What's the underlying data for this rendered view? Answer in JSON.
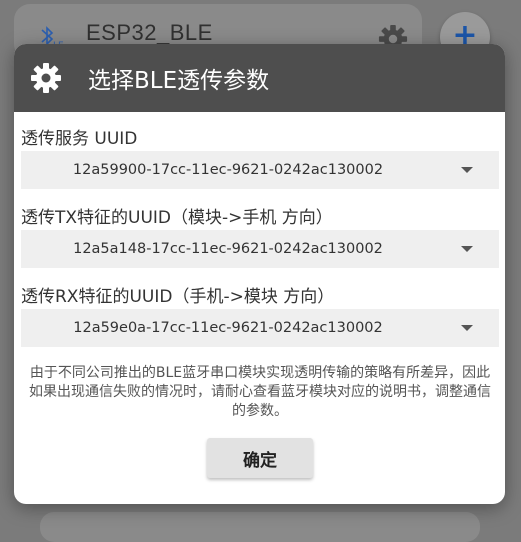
{
  "background": {
    "device_name": "ESP32_BLE",
    "ble_icon": "bluetooth-ble-icon",
    "settings_icon": "gear-icon",
    "add_icon": "plus-icon",
    "add_glyph": "+"
  },
  "dialog": {
    "icon": "gear-icon",
    "title": "选择BLE透传参数",
    "service": {
      "label": "透传服务 UUID",
      "value": "12a59900-17cc-11ec-9621-0242ac130002"
    },
    "tx": {
      "label": "透传TX特征的UUID（模块->手机 方向）",
      "value": "12a5a148-17cc-11ec-9621-0242ac130002"
    },
    "rx": {
      "label": "透传RX特征的UUID（手机->模块 方向）",
      "value": "12a59e0a-17cc-11ec-9621-0242ac130002"
    },
    "note": "由于不同公司推出的BLE蓝牙串口模块实现透明传输的策略有所差异，因此如果出现通信失败的情况时，请耐心查看蓝牙模块对应的说明书，调整通信的参数。",
    "confirm_label": "确定"
  },
  "colors": {
    "header": "#4e4e4e",
    "dim_background": "#7b7b7b",
    "select_background": "#efefef",
    "accent_blue": "#1b55a8"
  }
}
